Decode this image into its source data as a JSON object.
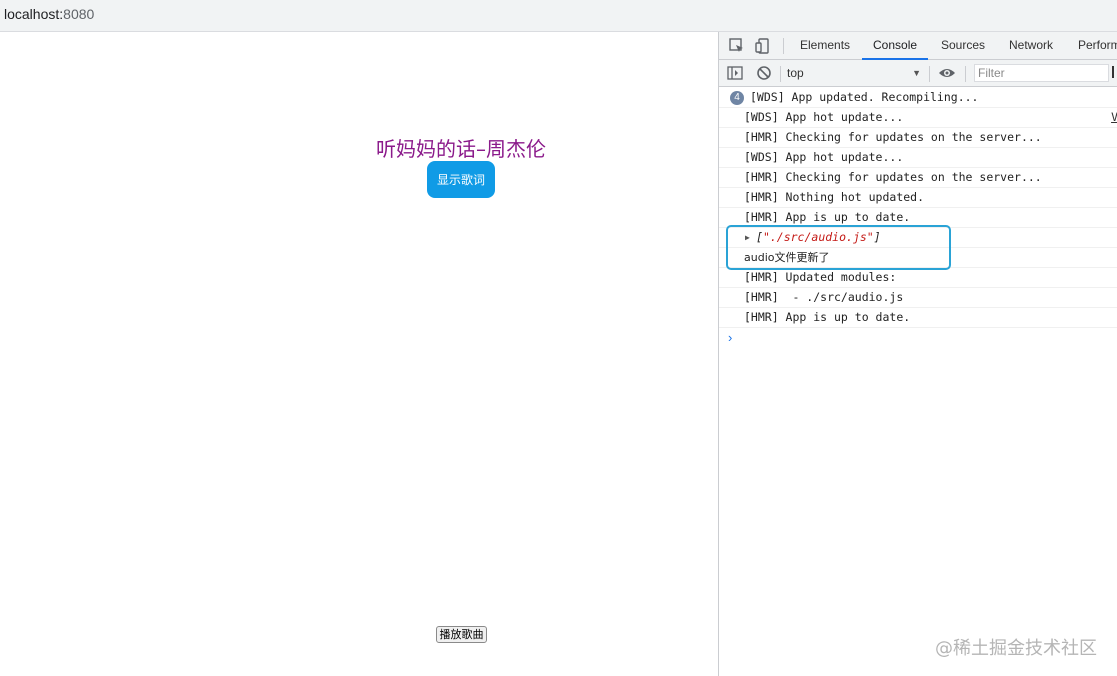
{
  "browser": {
    "url_host": "localhost:",
    "url_port": "8080"
  },
  "page": {
    "title": "听妈妈的话–周杰伦",
    "lyrics_button": "显示歌词",
    "play_button": "播放歌曲"
  },
  "devtools": {
    "tabs": [
      "Elements",
      "Console",
      "Sources",
      "Network",
      "Perform"
    ],
    "active_tab": "Console",
    "context": "top",
    "filter_placeholder": "Filter",
    "console": {
      "badge_count": "4",
      "badge_message": "[WDS] App updated. Recompiling...",
      "source_link": "V",
      "messages": [
        "[WDS] App hot update...",
        "[HMR] Checking for updates on the server...",
        "[WDS] App hot update...",
        "[HMR] Checking for updates on the server...",
        "[HMR] Nothing hot updated.",
        "[HMR] App is up to date."
      ],
      "array_open": "[",
      "array_value": "\"./src/audio.js\"",
      "array_close": "]",
      "log_text": "audio文件更新了",
      "messages_after": [
        "[HMR] Updated modules:",
        "[HMR]  - ./src/audio.js",
        "[HMR] App is up to date."
      ],
      "prompt": "›"
    }
  },
  "watermark": "@稀土掘金技术社区",
  "colors": {
    "title": "#8b1a8b",
    "lyrics_button_bg": "#109be6",
    "highlight_border": "#2aa3d6",
    "active_tab_underline": "#1a73e8"
  }
}
